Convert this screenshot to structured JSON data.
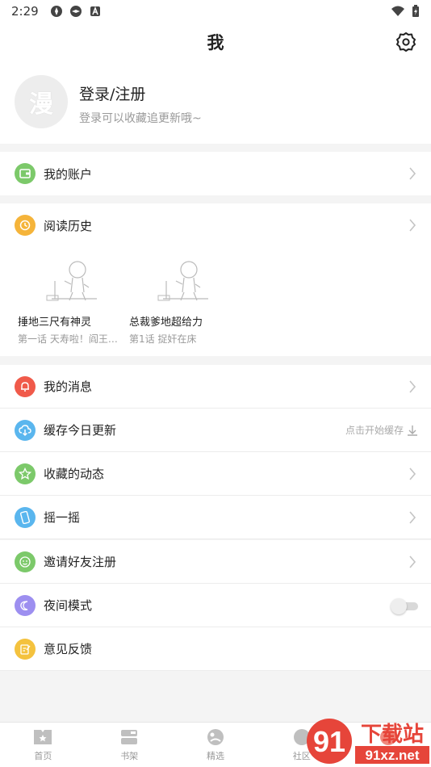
{
  "status": {
    "time": "2:29"
  },
  "header": {
    "title": "我"
  },
  "profile": {
    "avatar_char": "漫",
    "login": "登录/注册",
    "subtitle": "登录可以收藏追更新哦~"
  },
  "account": {
    "label": "我的账户"
  },
  "history": {
    "label": "阅读历史",
    "items": [
      {
        "title": "捶地三尺有神灵",
        "sub": "第一话 天寿啦！阎王…"
      },
      {
        "title": "总裁爹地超给力",
        "sub": "第1话 捉奸在床"
      }
    ]
  },
  "menu": {
    "messages": "我的消息",
    "cache": "缓存今日更新",
    "cache_hint": "点击开始缓存",
    "favorites": "收藏的动态",
    "shake": "摇一摇",
    "invite": "邀请好友注册",
    "night": "夜间模式",
    "feedback": "意见反馈"
  },
  "tabs": [
    "首页",
    "书架",
    "精选",
    "社区"
  ],
  "watermark": {
    "brand": "下载站",
    "domain": "91xz.net",
    "digits": "91"
  },
  "colors": {
    "green": "#7cc96a",
    "orange": "#f5b43a",
    "red": "#f05a4a",
    "blue": "#5ab6ee",
    "purple": "#9d8ff0",
    "yellow": "#f4c23e"
  }
}
